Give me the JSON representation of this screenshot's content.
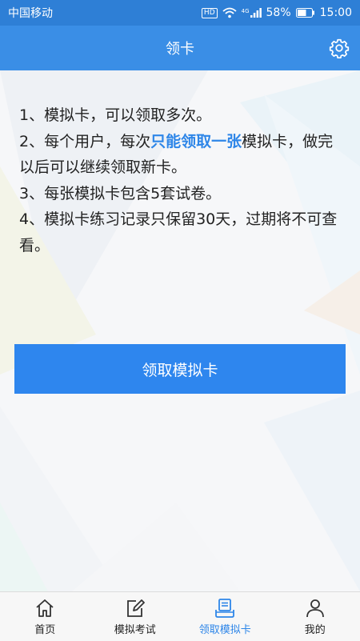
{
  "status": {
    "carrier": "中国移动",
    "hd": "HD",
    "signal_badge": "4G",
    "battery": "58%",
    "time": "15:00"
  },
  "header": {
    "title": "领卡"
  },
  "rules": {
    "line1": "1、模拟卡，可以领取多次。",
    "line2_prefix": "2、每个用户，每次",
    "line2_highlight": "只能领取一张",
    "line2_suffix": "模拟卡，做完以后可以继续领取新卡。",
    "line3": "3、每张模拟卡包含5套试卷。",
    "line4": "4、模拟卡练习记录只保留30天，过期将不可查看。"
  },
  "claim_button": {
    "label": "领取模拟卡"
  },
  "tabs": [
    {
      "label": "首页",
      "icon": "home-icon",
      "active": false
    },
    {
      "label": "模拟考试",
      "icon": "edit-icon",
      "active": false
    },
    {
      "label": "领取模拟卡",
      "icon": "card-stack-icon",
      "active": true
    },
    {
      "label": "我的",
      "icon": "person-icon",
      "active": false
    }
  ],
  "colors": {
    "header": "#3a8ee6",
    "status_bar": "#2e7fd6",
    "accent": "#2e86e8",
    "button": "#2e86ee"
  }
}
